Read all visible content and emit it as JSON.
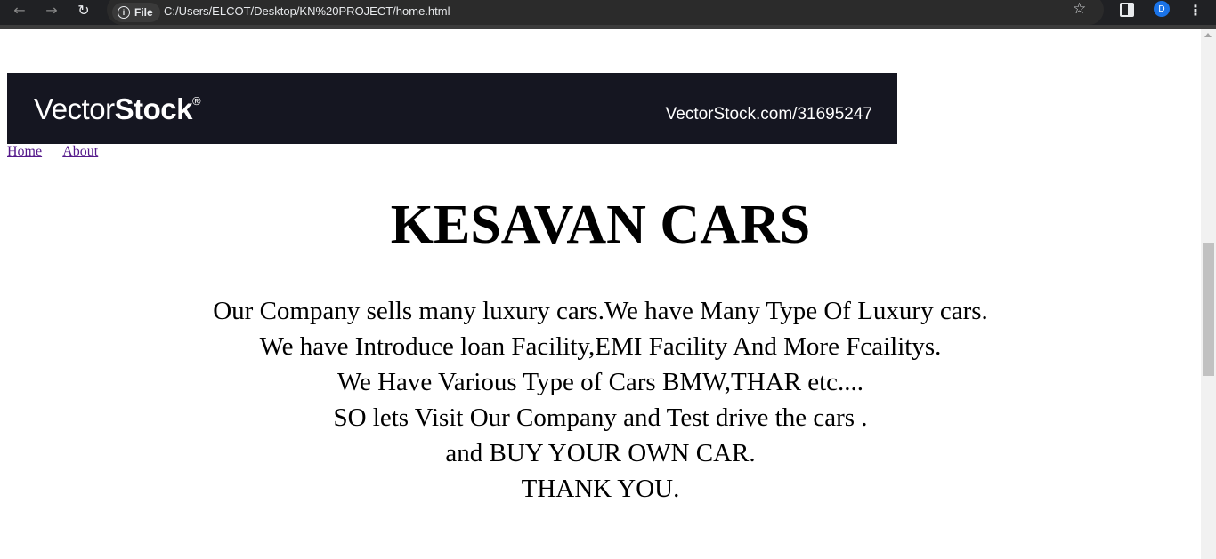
{
  "browser": {
    "back_icon": "arrow-left-icon",
    "forward_icon": "arrow-right-icon",
    "reload_icon": "reload-icon",
    "chip_label": "File",
    "url": "C:/Users/ELCOT/Desktop/KN%20PROJECT/home.html",
    "profile_initial": "D",
    "profile_color": "#1a73e8"
  },
  "banner": {
    "logo_light": "Vector",
    "logo_bold": "Stock",
    "logo_mark": "®",
    "site": "VectorStock.com/31695247",
    "background": "#151621"
  },
  "nav": {
    "home": "Home",
    "about": "About"
  },
  "page": {
    "title": "KESAVAN CARS",
    "lines": [
      "Our Company sells many luxury cars.We have Many Type Of Luxury cars.",
      "We have Introduce loan Facility,EMI Facility And More Fcailitys.",
      "We Have Various Type of Cars BMW,THAR etc....",
      "SO lets Visit Our Company and Test drive the cars .",
      "and BUY YOUR OWN CAR.",
      "THANK YOU."
    ]
  }
}
